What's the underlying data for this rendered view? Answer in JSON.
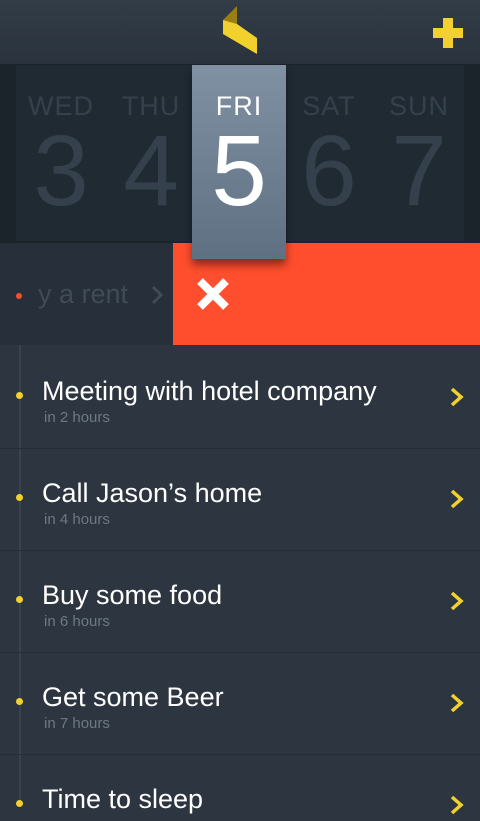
{
  "header": {
    "logo_icon": "folded-ribbon-logo",
    "add_icon": "plus-icon",
    "accent_color": "#f2d12d"
  },
  "days": [
    {
      "name": "WED",
      "number": "3"
    },
    {
      "name": "THU",
      "number": "4"
    },
    {
      "name": "FRI",
      "number": "5",
      "selected": true
    },
    {
      "name": "SAT",
      "number": "6"
    },
    {
      "name": "SUN",
      "number": "7"
    }
  ],
  "swiped_task": {
    "label": "y a rent",
    "delete_icon": "close-icon",
    "delete_color": "#ff4e2d"
  },
  "tasks": [
    {
      "title": "Meeting with hotel company",
      "subtitle": "in 2 hours"
    },
    {
      "title": "Call Jason’s home",
      "subtitle": "in 4 hours"
    },
    {
      "title": "Buy some food",
      "subtitle": "in 6 hours"
    },
    {
      "title": "Get some Beer",
      "subtitle": "in 7 hours"
    },
    {
      "title": "Time to sleep",
      "subtitle": ""
    }
  ]
}
